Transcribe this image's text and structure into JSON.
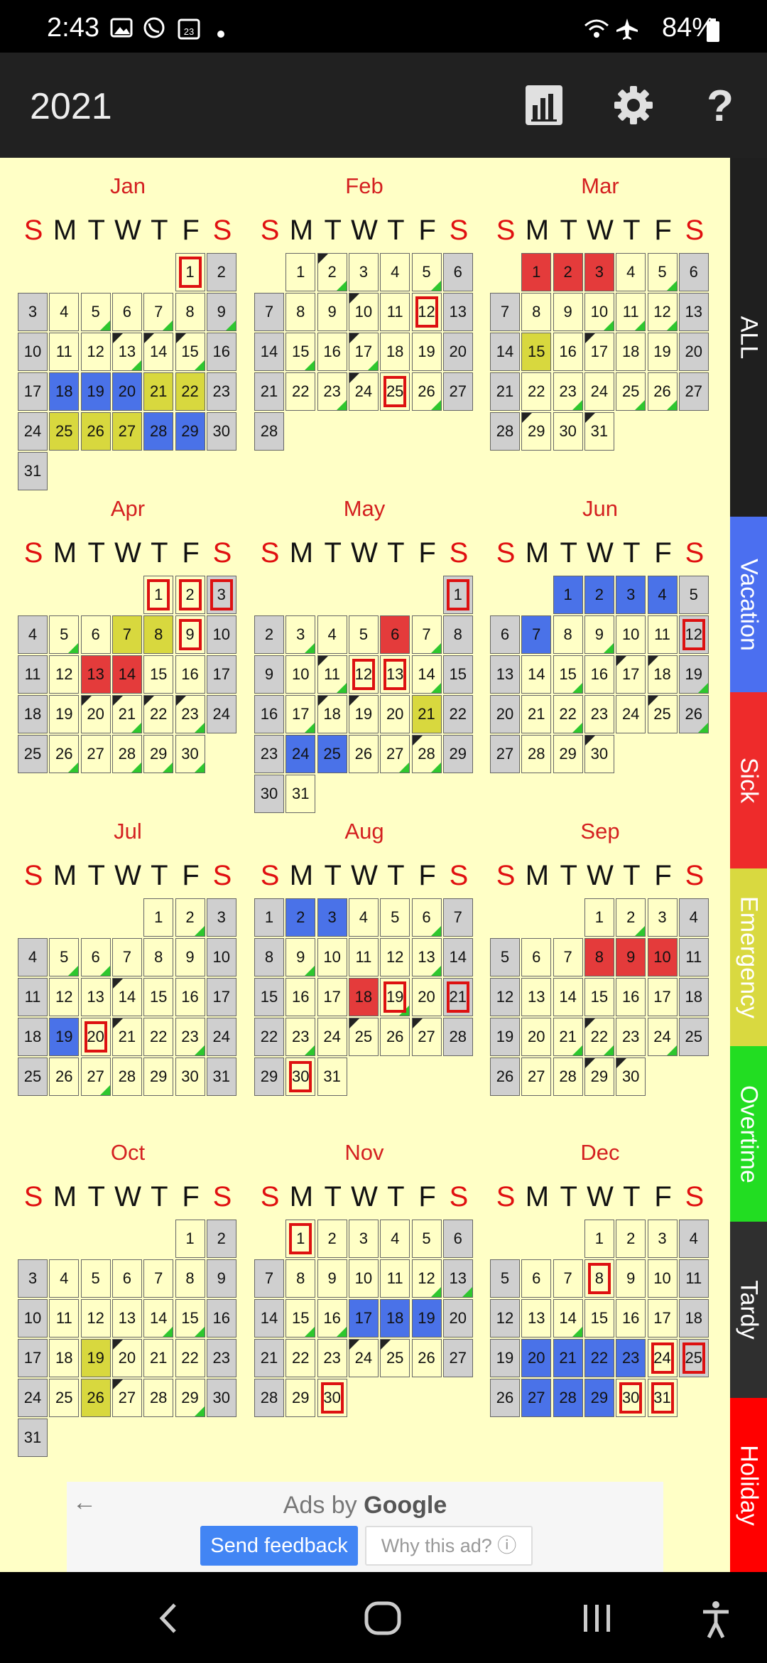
{
  "status": {
    "time": "2:43",
    "battery": "84%",
    "icons": [
      "image-icon",
      "viber-icon",
      "calendar-icon",
      "dot-icon",
      "wifi-icon",
      "airplane-icon",
      "battery-icon"
    ]
  },
  "appbar": {
    "title": "2021",
    "actions": [
      {
        "name": "stats-icon"
      },
      {
        "name": "settings-icon"
      },
      {
        "name": "help-icon"
      }
    ]
  },
  "weekdays": [
    "S",
    "M",
    "T",
    "W",
    "T",
    "F",
    "S"
  ],
  "months": [
    {
      "name": "Jan",
      "start": 5,
      "days": 31,
      "blue": [
        18,
        19,
        20,
        28,
        29
      ],
      "red": [],
      "yellow": [
        21,
        22,
        25,
        26,
        27
      ],
      "ring": [
        1
      ],
      "green": [
        5,
        7,
        9,
        13,
        15
      ],
      "note": [
        13,
        14,
        15
      ]
    },
    {
      "name": "Feb",
      "start": 1,
      "days": 28,
      "blue": [],
      "red": [],
      "yellow": [],
      "ring": [
        12,
        25
      ],
      "green": [
        2,
        5,
        15,
        17,
        23,
        26
      ],
      "note": [
        2,
        10,
        17,
        24
      ]
    },
    {
      "name": "Mar",
      "start": 1,
      "days": 31,
      "blue": [],
      "red": [
        1,
        2,
        3
      ],
      "yellow": [
        15
      ],
      "ring": [],
      "green": [
        5,
        10,
        11,
        12,
        23,
        25,
        26
      ],
      "note": [
        17,
        29,
        31
      ]
    },
    {
      "name": "Apr",
      "start": 4,
      "days": 30,
      "blue": [],
      "red": [
        13,
        14
      ],
      "yellow": [
        7,
        8
      ],
      "ring": [
        1,
        2,
        3,
        9
      ],
      "green": [
        5,
        21,
        23,
        26,
        28,
        29,
        30
      ],
      "note": [
        20,
        21,
        22,
        23
      ]
    },
    {
      "name": "May",
      "start": 6,
      "days": 31,
      "blue": [
        24,
        25
      ],
      "red": [
        6
      ],
      "yellow": [
        21
      ],
      "ring": [
        1,
        12,
        13
      ],
      "green": [
        3,
        7,
        11,
        14,
        17,
        27,
        28
      ],
      "note": [
        11,
        18,
        19,
        28
      ]
    },
    {
      "name": "Jun",
      "start": 2,
      "days": 30,
      "blue": [
        1,
        2,
        3,
        4,
        7
      ],
      "red": [],
      "yellow": [],
      "ring": [
        12
      ],
      "green": [
        9,
        15,
        19,
        22,
        26
      ],
      "note": [
        17,
        18,
        25,
        30
      ]
    },
    {
      "name": "Jul",
      "start": 4,
      "days": 31,
      "blue": [
        19
      ],
      "red": [],
      "yellow": [],
      "ring": [
        20
      ],
      "green": [
        2,
        5,
        6,
        23,
        27
      ],
      "note": [
        14,
        21
      ]
    },
    {
      "name": "Aug",
      "start": 0,
      "days": 31,
      "blue": [
        2,
        3
      ],
      "red": [
        18
      ],
      "yellow": [],
      "ring": [
        19,
        21,
        30
      ],
      "green": [
        6,
        9,
        13,
        19,
        23
      ],
      "note": [
        25,
        27
      ]
    },
    {
      "name": "Sep",
      "start": 3,
      "days": 30,
      "blue": [],
      "red": [
        8,
        9,
        10
      ],
      "yellow": [],
      "ring": [],
      "green": [
        2,
        21,
        22,
        24
      ],
      "note": [
        22,
        29,
        30
      ]
    },
    {
      "name": "Oct",
      "start": 5,
      "days": 31,
      "blue": [],
      "red": [],
      "yellow": [
        19,
        26
      ],
      "ring": [],
      "green": [
        14,
        15,
        29
      ],
      "note": [
        20,
        27
      ]
    },
    {
      "name": "Nov",
      "start": 1,
      "days": 30,
      "blue": [
        17,
        18,
        19
      ],
      "red": [],
      "yellow": [],
      "ring": [
        1,
        30
      ],
      "green": [
        12,
        13,
        15,
        16
      ],
      "note": [
        24,
        25
      ]
    },
    {
      "name": "Dec",
      "start": 3,
      "days": 31,
      "blue": [
        20,
        21,
        22,
        23,
        27,
        28,
        29
      ],
      "red": [],
      "yellow": [],
      "ring": [
        8,
        24,
        25,
        30,
        31
      ],
      "green": [
        14
      ],
      "note": []
    }
  ],
  "tabs": [
    {
      "label": "ALL",
      "color": "#1f1f1f"
    },
    {
      "label": "Vacation",
      "color": "#4b6ff0"
    },
    {
      "label": "Sick",
      "color": "#ee2b2b"
    },
    {
      "label": "Emergency",
      "color": "#d9d940"
    },
    {
      "label": "Overtime",
      "color": "#22dd22"
    },
    {
      "label": "Tardy",
      "color": "#2f2f2f"
    },
    {
      "label": "Holiday",
      "color": "#ff0000"
    }
  ],
  "ad": {
    "prefix": "Ads by",
    "brand": "Google",
    "feedback": "Send feedback",
    "why": "Why this ad? ⓘ"
  },
  "nav": {
    "icons": [
      "back-icon",
      "home-icon",
      "recents-icon",
      "accessibility-icon"
    ]
  }
}
